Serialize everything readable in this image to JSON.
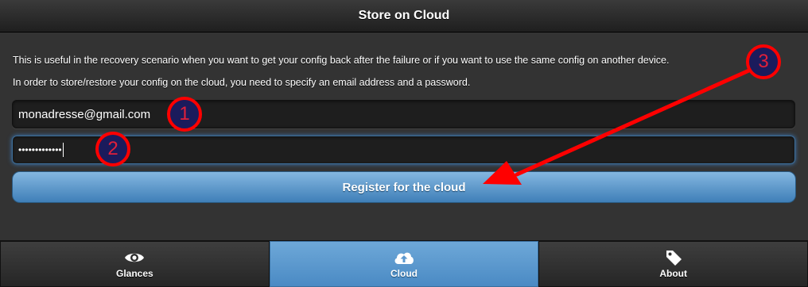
{
  "header": {
    "title": "Store on Cloud"
  },
  "content": {
    "description1": "This is useful in the recovery scenario when you want to get your config back after the failure or if you want to use the same config on another device.",
    "description2": "In order to store/restore your config on the cloud, you need to specify an email address and a password.",
    "email": {
      "value": "monadresse@gmail.com"
    },
    "password": {
      "masked_value": "•••••••••••••"
    },
    "register_button": "Register for the cloud"
  },
  "navbar": {
    "tabs": [
      {
        "label": "Glances",
        "icon": "eye-icon",
        "active": false
      },
      {
        "label": "Cloud",
        "icon": "cloud-upload-icon",
        "active": true
      },
      {
        "label": "About",
        "icon": "tag-icon",
        "active": false
      }
    ]
  },
  "annotations": {
    "badge1": "1",
    "badge2": "2",
    "badge3": "3"
  },
  "colors": {
    "accent": "#4a8ac4",
    "annotation_red": "#ff0000",
    "badge_fill": "#1b1b5c"
  }
}
